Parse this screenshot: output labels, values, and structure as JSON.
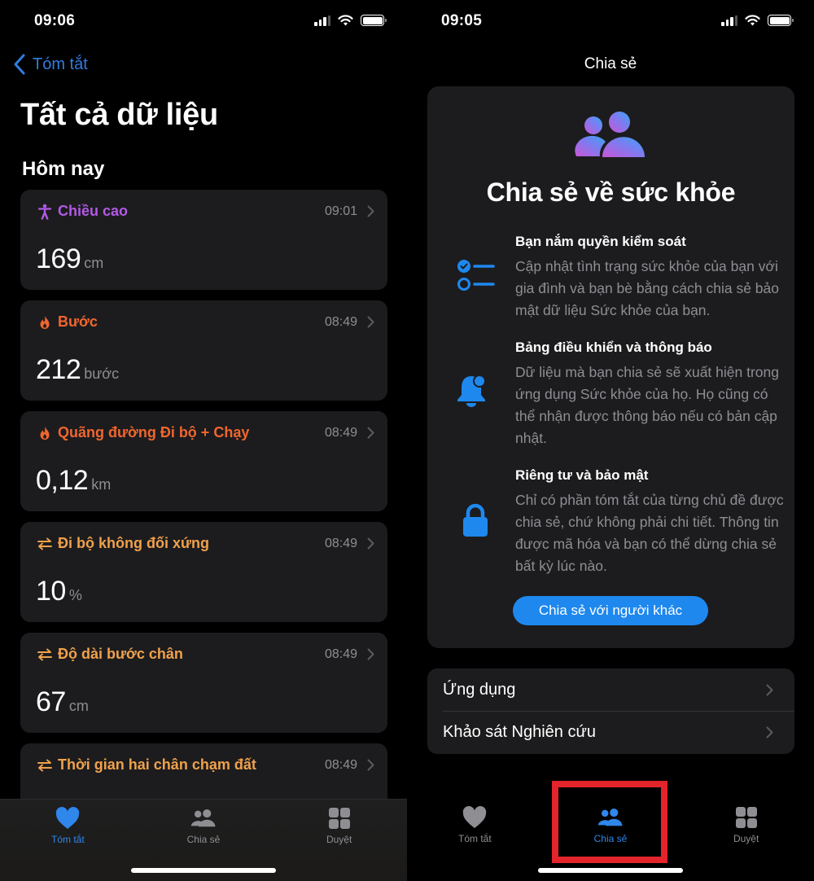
{
  "left_screen": {
    "status": {
      "time": "09:06"
    },
    "back_label": "Tóm tắt",
    "title": "Tất cả dữ liệu",
    "section": "Hôm nay",
    "cards": [
      {
        "label": "Chiều cao",
        "icon": "figure-person-icon",
        "color": "#b25ae6",
        "time": "09:01",
        "value": "169",
        "unit": "cm"
      },
      {
        "label": "Bước",
        "icon": "flame-icon",
        "color": "#f0662e",
        "time": "08:49",
        "value": "212",
        "unit": "bước"
      },
      {
        "label": "Quãng đường Đi bộ + Chạy",
        "icon": "flame-icon",
        "color": "#f0662e",
        "time": "08:49",
        "value": "0,12",
        "unit": "km"
      },
      {
        "label": "Đi bộ không đối xứng",
        "icon": "arrows-swap-icon",
        "color": "#f0a14b",
        "time": "08:49",
        "value": "10",
        "unit": "%"
      },
      {
        "label": "Độ dài bước chân",
        "icon": "arrows-swap-icon",
        "color": "#f0a14b",
        "time": "08:49",
        "value": "67",
        "unit": "cm"
      },
      {
        "label": "Thời gian hai chân chạm đất",
        "icon": "arrows-swap-icon",
        "color": "#f0a14b",
        "time": "08:49",
        "value": "",
        "unit": ""
      }
    ],
    "tabs": [
      {
        "label": "Tóm tắt",
        "icon": "heart-icon",
        "active": true
      },
      {
        "label": "Chia sẻ",
        "icon": "people-icon",
        "active": false
      },
      {
        "label": "Duyệt",
        "icon": "grid-icon",
        "active": false
      }
    ]
  },
  "right_screen": {
    "status": {
      "time": "09:05"
    },
    "nav_title": "Chia sẻ",
    "hero_title": "Chia sẻ về sức khỏe",
    "features": [
      {
        "icon": "checklist-icon",
        "title": "Bạn nắm quyền kiểm soát",
        "description": "Cập nhật tình trạng sức khỏe của bạn với gia đình và bạn bè bằng cách chia sẻ bảo mật dữ liệu Sức khỏe của bạn."
      },
      {
        "icon": "bell-badge-icon",
        "title": "Bảng điều khiển và thông báo",
        "description": "Dữ liệu mà bạn chia sẻ sẽ xuất hiện trong ứng dụng Sức khỏe của họ. Họ cũng có thể nhận được thông báo nếu có bản cập nhật."
      },
      {
        "icon": "lock-icon",
        "title": "Riêng tư và bảo mật",
        "description": "Chỉ có phần tóm tắt của từng chủ đề được chia sẻ, chứ không phải chi tiết. Thông tin được mã hóa và bạn có thể dừng chia sẻ bất kỳ lúc nào."
      }
    ],
    "share_button": "Chia sẻ với người khác",
    "list": [
      {
        "label": "Ứng dụng"
      },
      {
        "label": "Khảo sát Nghiên cứu"
      }
    ],
    "tabs": [
      {
        "label": "Tóm tắt",
        "icon": "heart-icon",
        "active": false
      },
      {
        "label": "Chia sẻ",
        "icon": "people-icon",
        "active": true
      },
      {
        "label": "Duyệt",
        "icon": "grid-icon",
        "active": false
      }
    ],
    "highlight_color": "#e3242b"
  },
  "colors": {
    "accent_blue": "#1e88ef",
    "card_bg": "#1c1c1e",
    "secondary_text": "#8e8e93"
  }
}
